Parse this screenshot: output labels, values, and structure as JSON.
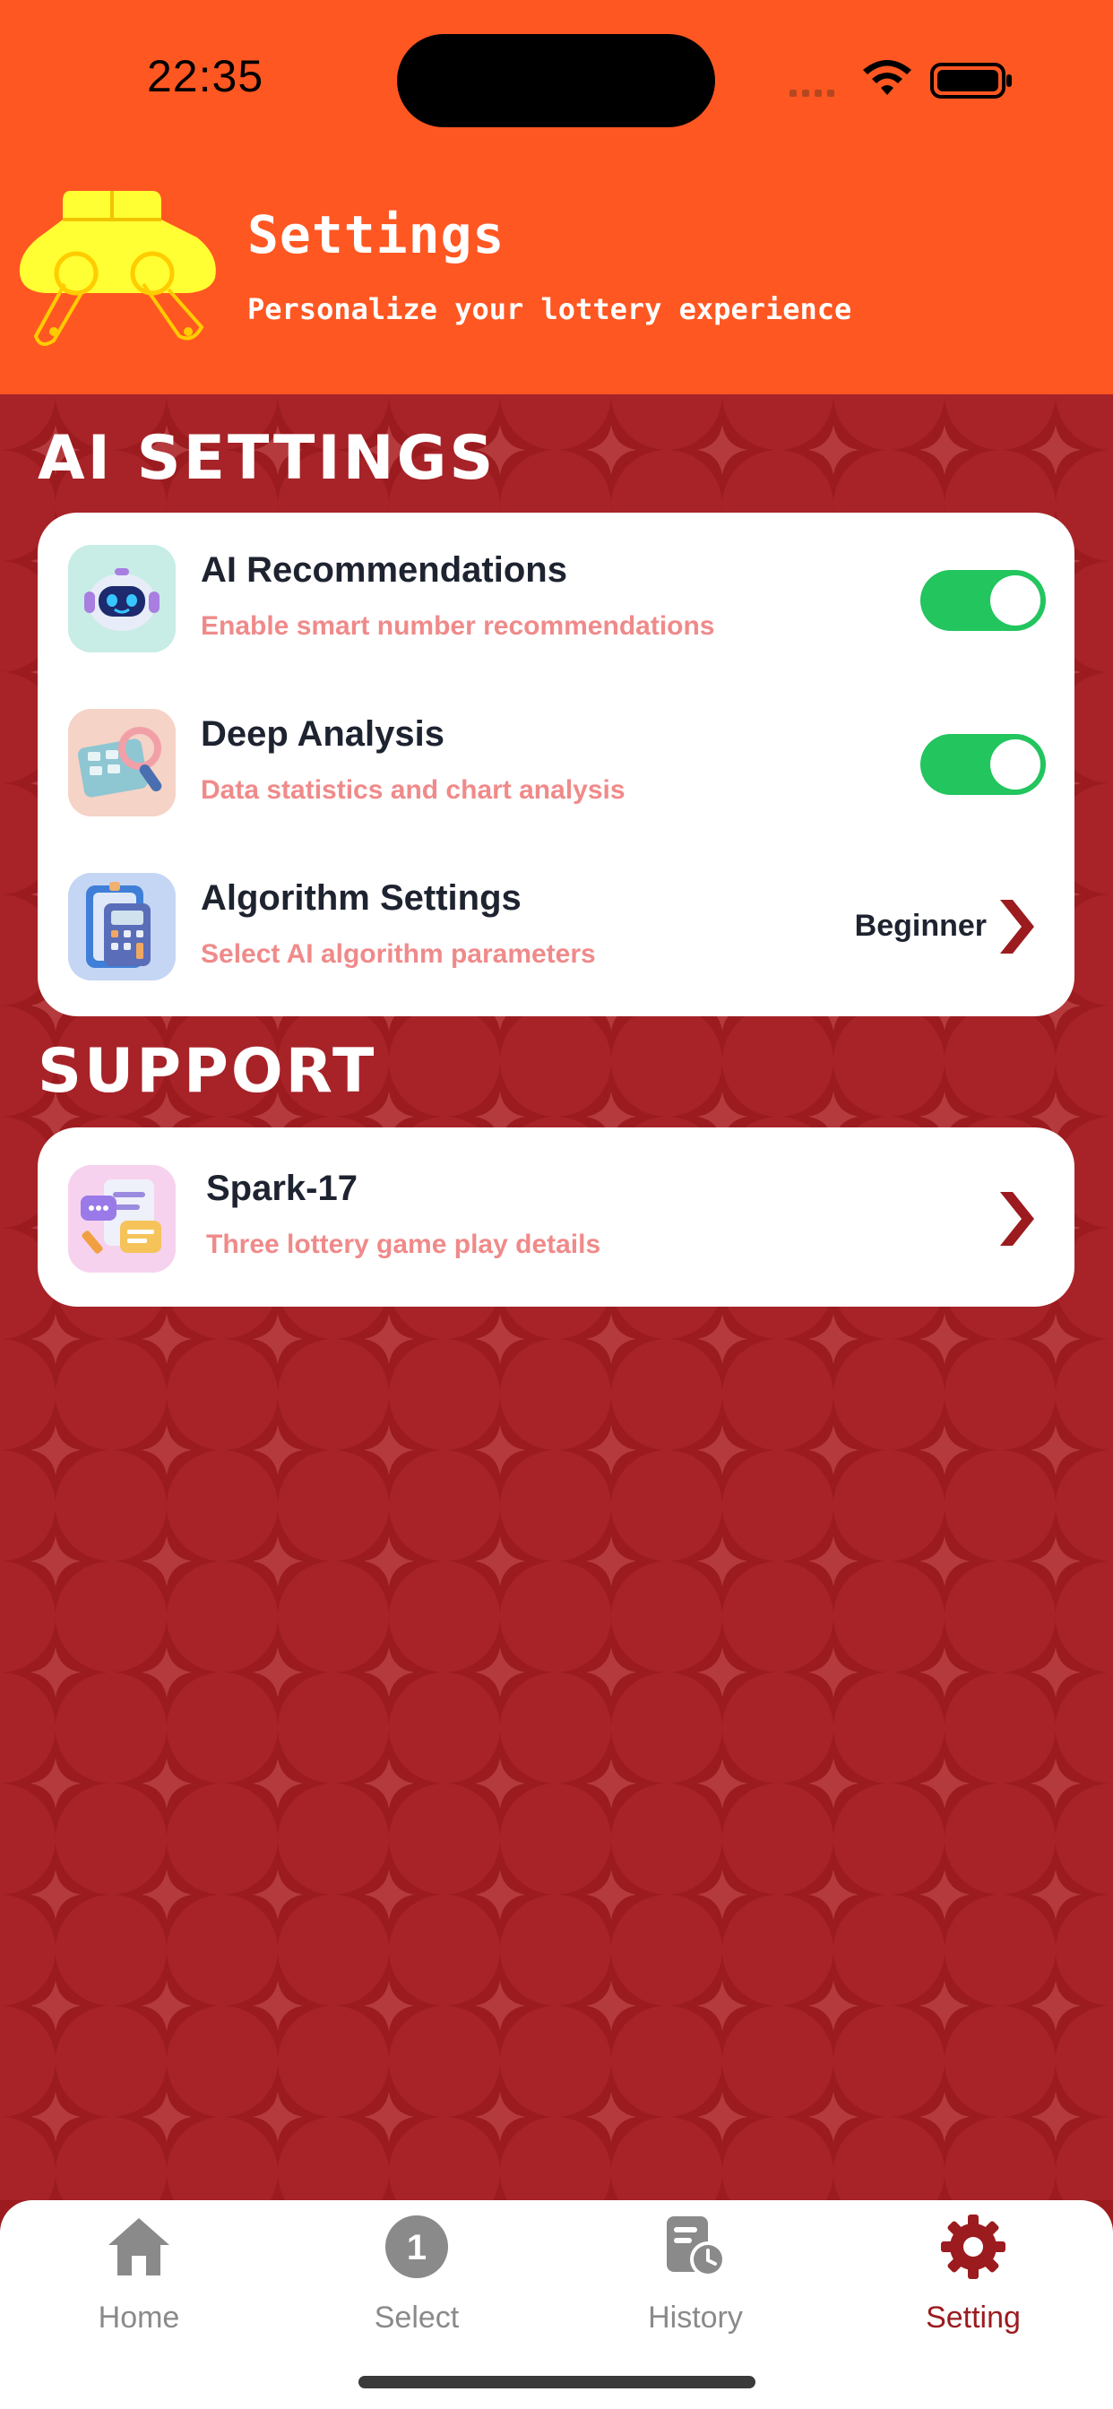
{
  "status_bar": {
    "time": "22:35",
    "icons": [
      "signal-icon",
      "wifi-icon",
      "battery-icon"
    ]
  },
  "header": {
    "title": "Settings",
    "subtitle": "Personalize your lottery experience",
    "logo_icon": "robot-logo-icon"
  },
  "sections": {
    "ai_settings": {
      "heading": "AI SETTINGS",
      "items": [
        {
          "title": "AI Recommendations",
          "subtitle": "Enable smart number recommendations",
          "icon": "robot-icon",
          "control": "toggle",
          "enabled": true
        },
        {
          "title": "Deep Analysis",
          "subtitle": "Data statistics and chart analysis",
          "icon": "analysis-icon",
          "control": "toggle",
          "enabled": true
        },
        {
          "title": "Algorithm Settings",
          "subtitle": "Select AI algorithm parameters",
          "icon": "calculator-icon",
          "control": "disclosure",
          "value": "Beginner"
        }
      ]
    },
    "support": {
      "heading": "SUPPORT",
      "items": [
        {
          "title": "Spark-17",
          "subtitle": "Three lottery game play details",
          "icon": "chat-document-icon",
          "control": "disclosure"
        }
      ]
    }
  },
  "tabbar": {
    "tabs": [
      {
        "label": "Home",
        "icon": "home-icon",
        "active": false
      },
      {
        "label": "Select",
        "icon": "number-one-icon",
        "active": false,
        "badge": "1"
      },
      {
        "label": "History",
        "icon": "history-clock-icon",
        "active": false
      },
      {
        "label": "Setting",
        "icon": "gear-icon",
        "active": true
      }
    ]
  },
  "colors": {
    "header_bg": "#ff5722",
    "page_bg": "#9b1b1f",
    "accent": "#9b1b1f",
    "toggle_on": "#22c55e",
    "subtitle_text": "#f08a8a",
    "title_text": "#1e2330",
    "inactive_tab": "#8a8a8a"
  }
}
